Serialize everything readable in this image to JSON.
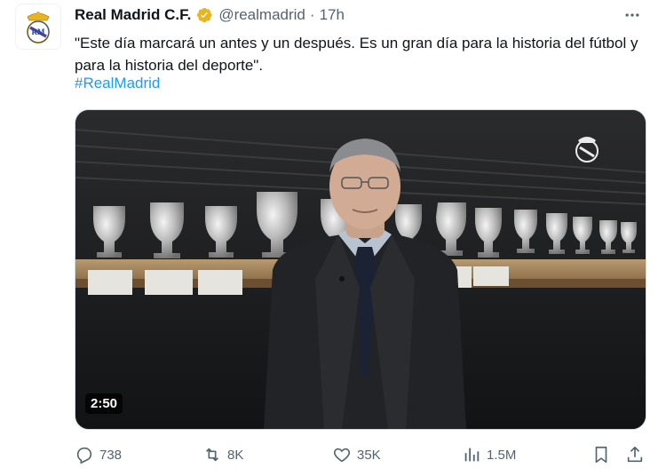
{
  "author": {
    "name": "Real Madrid C.F.",
    "handle": "@realmadrid",
    "separator": "·",
    "time": "17h",
    "verified_color": "#e8b422"
  },
  "tweet": {
    "text": "\"Este día marcará un antes y un después. Es un gran día para la historia del fútbol y para la historia del deporte\".",
    "hashtag": "#RealMadrid"
  },
  "media": {
    "duration": "2:50"
  },
  "actions": {
    "replies": "738",
    "retweets": "8K",
    "likes": "35K",
    "views": "1.5M"
  },
  "colors": {
    "accent": "#1d9bf0",
    "muted": "#536471"
  },
  "icons": {
    "more": "more-icon",
    "reply": "reply-icon",
    "retweet": "retweet-icon",
    "like": "heart-icon",
    "views": "views-icon",
    "bookmark": "bookmark-icon",
    "share": "share-icon"
  }
}
